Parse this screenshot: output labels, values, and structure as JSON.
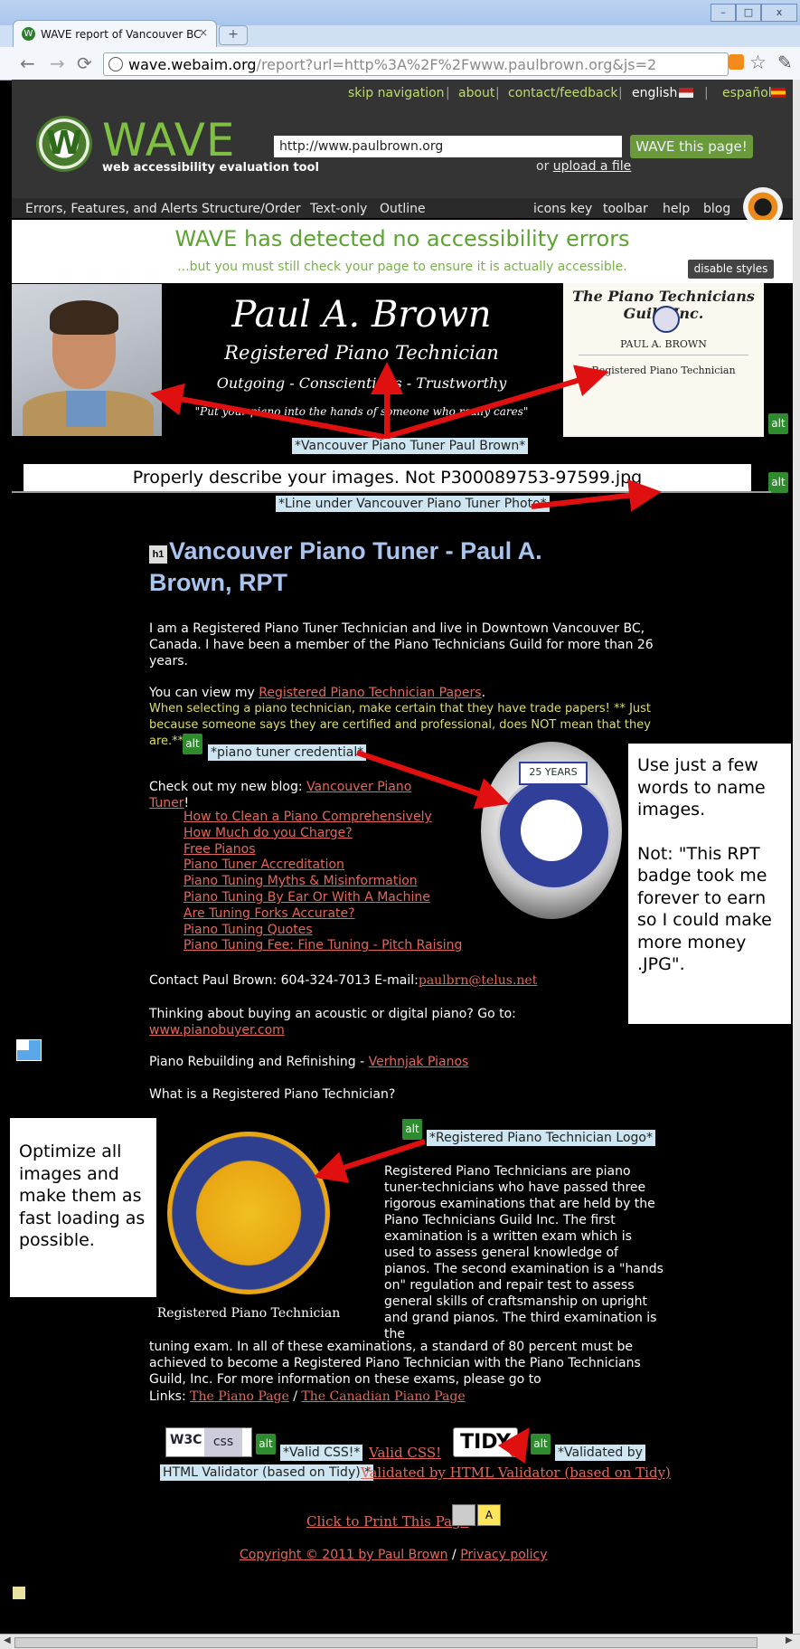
{
  "browser": {
    "tab_title": "WAVE report of Vancouver BC",
    "tab_close": "×",
    "new_tab": "+",
    "window_controls": [
      "–",
      "□",
      "x"
    ],
    "url_domain": "wave.webaim.org",
    "url_rest": "/report?url=http%3A%2F%2Fwww.paulbrown.org&js=2",
    "icons": [
      "back-icon",
      "forward-icon",
      "reload-icon",
      "page-icon",
      "rss-icon",
      "star-icon",
      "wrench-icon"
    ]
  },
  "wave": {
    "top_nav": [
      "skip navigation",
      "about",
      "contact/feedback",
      "english",
      "español"
    ],
    "separator": "|",
    "wordmark": "WAVE",
    "tagline": "web accessibility evaluation tool",
    "url_value": "http://www.paulbrown.org",
    "submit_label": "WAVE this page!",
    "upload_prefix": "or",
    "upload_link": "upload a file",
    "tabs": [
      "Errors, Features, and Alerts",
      "Structure/Order",
      "Text-only",
      "Outline"
    ],
    "right_links": [
      "icons key",
      "toolbar",
      "help",
      "blog"
    ],
    "result_title": "WAVE has detected no accessibility errors",
    "result_sub": "...but you must still check your page to ensure it is actually accessible.",
    "disable_styles": "disable styles"
  },
  "banner": {
    "name": "Paul A. Brown",
    "title": "Registered Piano Technician",
    "traits": "Outgoing - Conscientious - Trustworthy",
    "quote": "\"Put your piano into the hands of someone who really cares\"",
    "cert_head": "The Piano Technicians Guild Inc.",
    "cert_name": "PAUL A. BROWN",
    "cert_title": "Registered Piano Technician",
    "alt_text": "*Vancouver Piano Tuner Paul Brown*"
  },
  "alt_badge": "alt",
  "annotations": {
    "describe": "Properly describe your images. Not P300089753-97599.jpg",
    "few_words": [
      "Use just a few words to name images.",
      "Not: \"This RPT badge took me forever to earn so I could make more money .JPG\"."
    ],
    "optimize": "Optimize all images and make them as fast loading as possible."
  },
  "line_alt": "*Line under Vancouver Piano Tuner Photo*",
  "content": {
    "h1_marker": "h1",
    "h1": "Vancouver Piano Tuner - Paul A. Brown, RPT",
    "intro": "I am a Registered Piano Tuner Technician and live in Downtown Vancouver BC, Canada. I have been a member of the Piano Technicians Guild for more than 26 years.",
    "view_prefix": "You can view my ",
    "view_link": "Registered Piano Technician Papers",
    "view_suffix": ".",
    "warning": "When selecting a piano technician, make certain that they have trade papers! ** Just because someone says they are certified and professional, does NOT mean that they are.**",
    "credential_alt": "*piano tuner credential*",
    "badge_top": "25 YEARS",
    "blog_prefix": "Check out my new blog: ",
    "blog_link": "Vancouver Piano Tuner",
    "blog_suffix": "!",
    "blog_items": [
      "How to Clean a Piano Comprehensively",
      "How Much do you Charge?",
      "Free Pianos",
      "Piano Tuner Accreditation",
      "Piano Tuning Myths & Misinformation",
      "Piano Tuning By Ear Or With A Machine",
      "Are Tuning Forks Accurate?",
      "Piano Tuning Quotes",
      "Piano Tuning Fee: Fine Tuning - Pitch Raising"
    ],
    "contact_prefix": "Contact Paul Brown: 604-324-7013 E-mail:",
    "contact_email": "paulbrn@telus.net",
    "buy_text": "Thinking about buying an acoustic or digital piano? Go to:",
    "buy_link": "www.pianobuyer.com",
    "rebuild_prefix": "Piano Rebuilding and Refinishing - ",
    "rebuild_link": "Verhnjak Pianos",
    "whatis": "What is a Registered Piano Technician?",
    "logo_caption": "Registered Piano Technician",
    "rpt_alt": "*Registered Piano Technician Logo*",
    "rpt_para": "Registered Piano Technicians are piano tuner-technicians who have passed three rigorous examinations that are held by the Piano Technicians Guild Inc. The first examination is a written exam which is used to assess general knowledge of pianos. The second examination is a \"hands on\" regulation and repair test to assess general skills of craftsmanship on upright and grand pianos. The third examination is the",
    "rpt_para2": "tuning exam. In all of these examinations, a standard of 80 percent must be achieved to become a Registered Piano Technician with the Piano Technicians Guild, Inc. For more information on these exams, please go to",
    "links_prefix": "Links: ",
    "link_a": "The Piano Page",
    "link_sep": " / ",
    "link_b": "The Canadian Piano Page"
  },
  "footer": {
    "w3c_text": "W3C",
    "w3c_css": "css",
    "css_alt": "*Valid CSS!*",
    "valid_css": "Valid CSS!",
    "tidy_text": "TIDY",
    "tidy_alt_a": "*Validated by",
    "tidy_alt_b": "HTML Validator (based on Tidy) *",
    "valid_html": "Validated by HTML Validator (based on Tidy)",
    "print": "Click to Print This Page",
    "copyright_link": "Copyright © 2011 by Paul Brown",
    "copyright_sep": " / ",
    "privacy_link": "Privacy policy"
  },
  "colors": {
    "wave_green": "#5ca332",
    "alt_green": "#2e8b2e",
    "link": "#e2685a",
    "heading": "#a9c4ee",
    "arrow": "#e01010"
  }
}
